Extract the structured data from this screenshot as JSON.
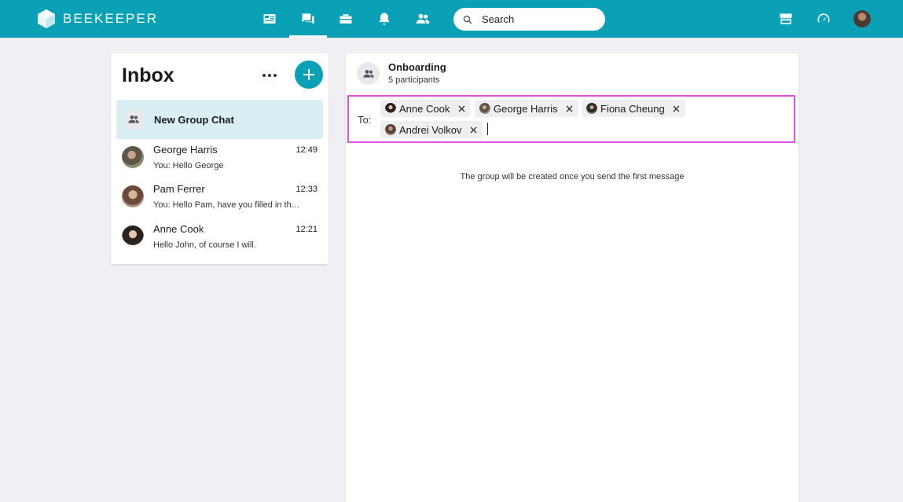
{
  "app": {
    "logo_text": "BEEKEEPER"
  },
  "topbar": {
    "nav": [
      {
        "icon": "news-feed-icon"
      },
      {
        "icon": "chat-icon",
        "active": true
      },
      {
        "icon": "toolbox-icon"
      },
      {
        "icon": "bell-icon"
      },
      {
        "icon": "people-icon"
      }
    ],
    "search_placeholder": "Search",
    "right_icons": [
      "marketplace-icon",
      "dashboard-gauge-icon",
      "user-avatar"
    ]
  },
  "inbox": {
    "title": "Inbox",
    "new_group_label": "New Group Chat",
    "conversations": [
      {
        "name": "George Harris",
        "time": "12:49",
        "preview": "You: Hello George"
      },
      {
        "name": "Pam Ferrer",
        "time": "12:33",
        "preview": "You: Hello Pam, have you filled in the form?"
      },
      {
        "name": "Anne Cook",
        "time": "12:21",
        "preview": "Hello John, of course I will."
      }
    ]
  },
  "chat": {
    "title": "Onboarding",
    "subtitle": "5 participants",
    "to_label": "To:",
    "recipients": [
      {
        "name": "Anne Cook"
      },
      {
        "name": "George Harris"
      },
      {
        "name": "Fiona Cheung"
      },
      {
        "name": "Andrei Volkov"
      }
    ],
    "info_text": "The group will be created once you send the first message"
  },
  "colors": {
    "brand": "#0aa1b6",
    "selected_row": "#d8eff3",
    "focus_border": "#e54ee0"
  }
}
